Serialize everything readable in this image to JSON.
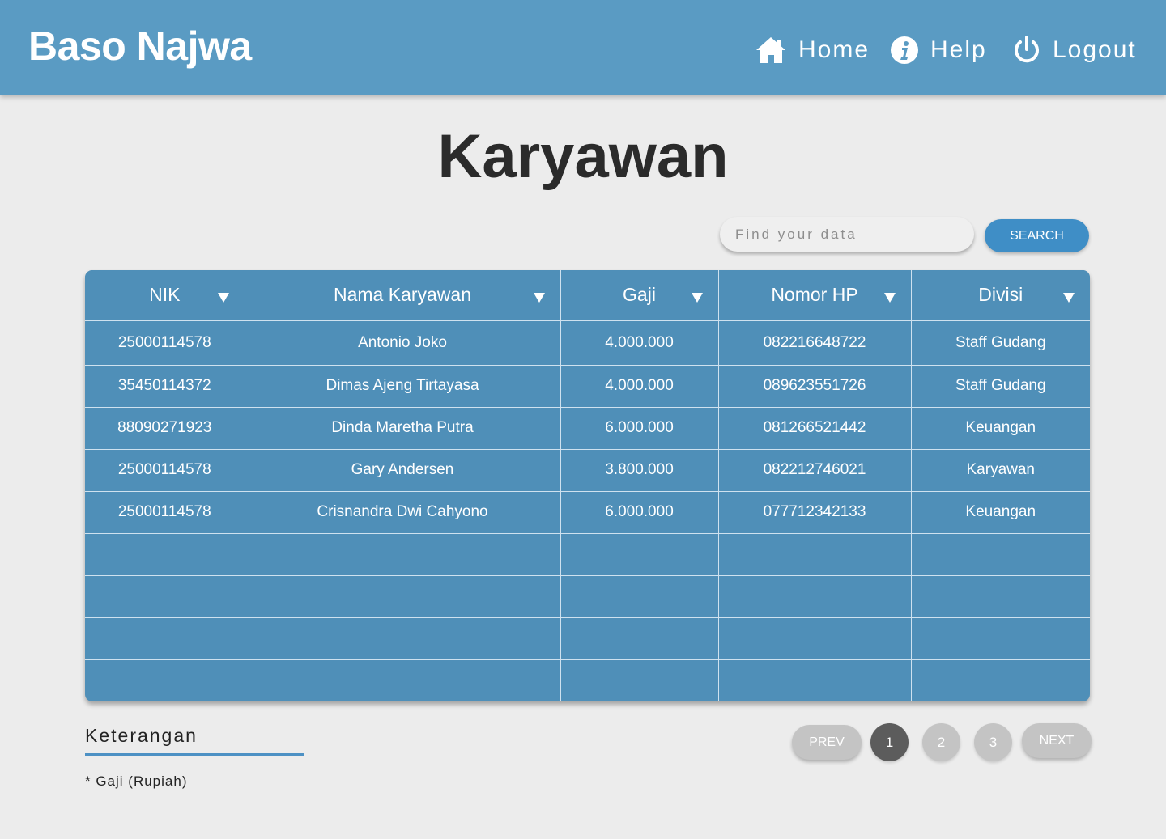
{
  "header": {
    "brand": "Baso Najwa",
    "nav": {
      "home": "Home",
      "help": "Help",
      "logout": "Logout"
    }
  },
  "page": {
    "title": "Karyawan"
  },
  "search": {
    "placeholder": "Find your data",
    "button": "SEARCH"
  },
  "table": {
    "headers": [
      "NIK",
      "Nama Karyawan",
      "Gaji",
      "Nomor HP",
      "Divisi"
    ],
    "rows": [
      [
        "25000114578",
        "Antonio Joko",
        "4.000.000",
        "082216648722",
        "Staff Gudang"
      ],
      [
        "35450114372",
        "Dimas Ajeng Tirtayasa",
        "4.000.000",
        "089623551726",
        "Staff Gudang"
      ],
      [
        "88090271923",
        "Dinda Maretha Putra",
        "6.000.000",
        "081266521442",
        "Keuangan"
      ],
      [
        "25000114578",
        "Gary Andersen",
        "3.800.000",
        "082212746021",
        "Karyawan"
      ],
      [
        "25000114578",
        "Crisnandra Dwi Cahyono",
        "6.000.000",
        "077712342133",
        "Keuangan"
      ],
      [
        "",
        "",
        "",
        "",
        ""
      ],
      [
        "",
        "",
        "",
        "",
        ""
      ],
      [
        "",
        "",
        "",
        "",
        ""
      ],
      [
        "",
        "",
        "",
        "",
        ""
      ]
    ]
  },
  "notes": {
    "title": "Keterangan",
    "text": "* Gaji (Rupiah)"
  },
  "pagination": {
    "prev": "PREV",
    "next": "NEXT",
    "pages": [
      "1",
      "2",
      "3"
    ],
    "current": "1"
  },
  "colors": {
    "header": "#5a9bc3",
    "table": "#4f8fb8",
    "accent": "#3f8ec6",
    "active_page": "#5c5c5c",
    "inactive_page": "#c4c4c4"
  }
}
